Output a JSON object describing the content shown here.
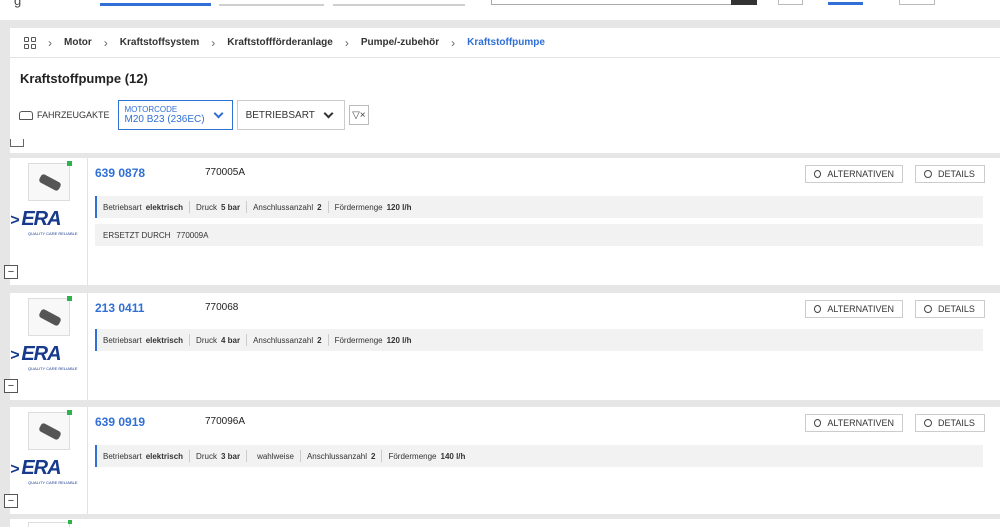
{
  "header": {
    "truncated_text": "g"
  },
  "breadcrumb": {
    "items": [
      "Motor",
      "Kraftstoffsystem",
      "Kraftstoffförderanlage",
      "Pumpe/-zubehör"
    ],
    "current": "Kraftstoffpumpe"
  },
  "page": {
    "title": "Kraftstoffpumpe (12)"
  },
  "filters": {
    "fahrzeugakte": "FAHRZEUGAKTE",
    "motorcode_label": "MOTORCODE",
    "motorcode_value": "M20 B23 (236EC)",
    "betriebsart": "BETRIEBSART"
  },
  "labels": {
    "alternativen": "ALTERNATIVEN",
    "details": "DETAILS",
    "ersetzt": "ERSETZT DURCH",
    "brand": "ERA",
    "brand_tagline": "QUALITY CARE RELIABLE"
  },
  "items": [
    {
      "artnr": "639 0878",
      "refnr": "770005A",
      "attributes": [
        {
          "k": "Betriebsart",
          "v": "elektrisch"
        },
        {
          "k": "Druck",
          "v": "5 bar"
        },
        {
          "k": "Anschlussanzahl",
          "v": "2"
        },
        {
          "k": "Fördermenge",
          "v": "120 l/h"
        }
      ],
      "ersetzt": "770009A"
    },
    {
      "artnr": "213 0411",
      "refnr": "770068",
      "attributes": [
        {
          "k": "Betriebsart",
          "v": "elektrisch"
        },
        {
          "k": "Druck",
          "v": "4 bar"
        },
        {
          "k": "Anschlussanzahl",
          "v": "2"
        },
        {
          "k": "Fördermenge",
          "v": "120 l/h"
        }
      ]
    },
    {
      "artnr": "639 0919",
      "refnr": "770096A",
      "attributes": [
        {
          "k": "Betriebsart",
          "v": "elektrisch"
        },
        {
          "k": "Druck",
          "v": "3 bar"
        },
        {
          "k": "",
          "v": "wahlweise"
        },
        {
          "k": "Anschlussanzahl",
          "v": "2"
        },
        {
          "k": "Fördermenge",
          "v": "140 l/h"
        }
      ]
    }
  ]
}
